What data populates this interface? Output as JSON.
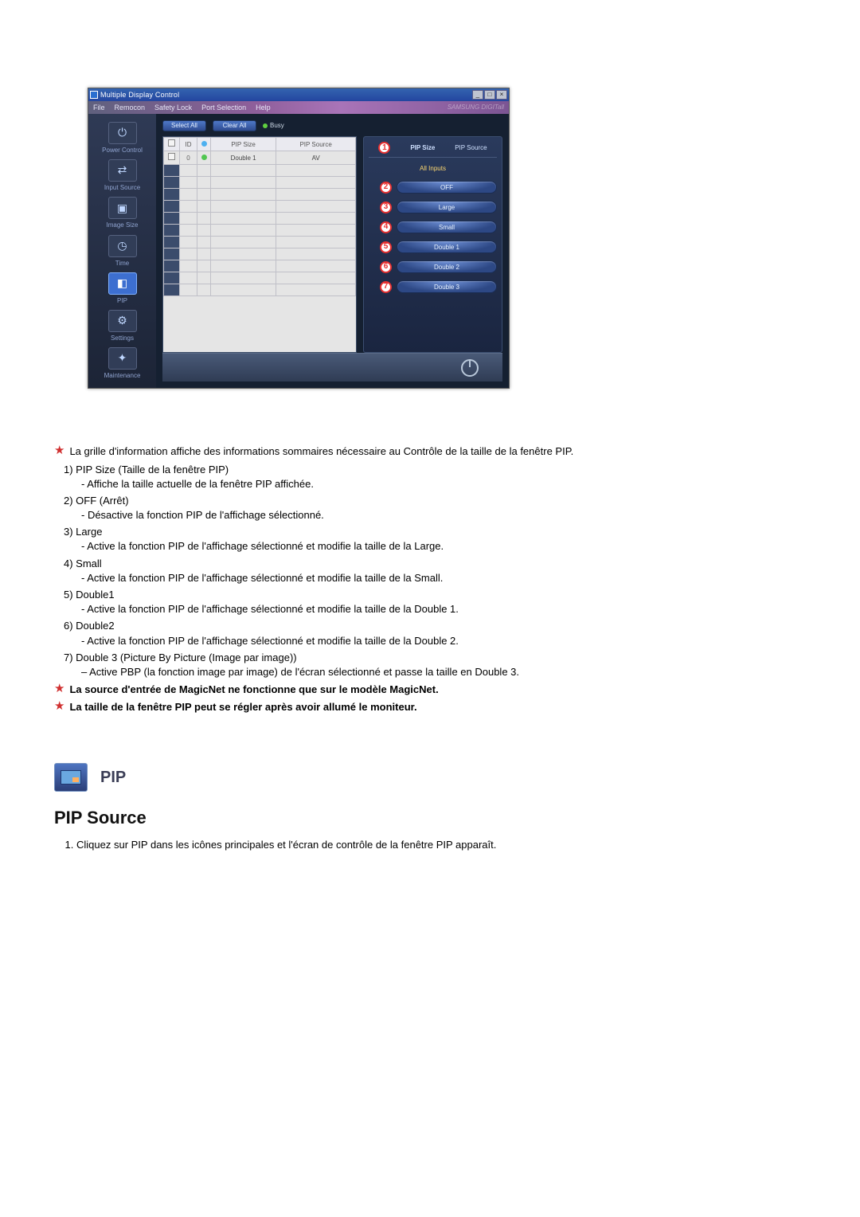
{
  "window": {
    "title": "Multiple Display Control",
    "brand": "SAMSUNG DIGITall"
  },
  "menu": [
    "File",
    "Remocon",
    "Safety Lock",
    "Port Selection",
    "Help"
  ],
  "sidebar": [
    {
      "label": "Power Control",
      "glyph": "⏻"
    },
    {
      "label": "Input Source",
      "glyph": "⇄"
    },
    {
      "label": "Image Size",
      "glyph": "▣"
    },
    {
      "label": "Time",
      "glyph": "◷"
    },
    {
      "label": "PIP",
      "glyph": "◧"
    },
    {
      "label": "Settings",
      "glyph": "⚙"
    },
    {
      "label": "Maintenance",
      "glyph": "✦"
    }
  ],
  "toolbar": {
    "select_all": "Select All",
    "clear_all": "Clear All",
    "busy": "Busy"
  },
  "table": {
    "headers": {
      "id": "ID",
      "pip_size": "PIP Size",
      "pip_source": "PIP Source"
    },
    "row": {
      "id": "0",
      "pip_size": "Double 1",
      "pip_source": "AV"
    }
  },
  "panel": {
    "pip_size_label": "PIP Size",
    "pip_source_label": "PIP Source",
    "all_inputs": "All Inputs",
    "options": [
      "OFF",
      "Large",
      "Small",
      "Double 1",
      "Double 2",
      "Double 3"
    ]
  },
  "notes": {
    "intro": "La grille d'information affiche des informations sommaires nécessaire au Contrôle de la taille de la fenêtre PIP.",
    "items": [
      {
        "h": "1)  PIP Size (Taille de la fenêtre PIP)",
        "b": "- Affiche la taille actuelle de la fenêtre PIP affichée."
      },
      {
        "h": "2)  OFF (Arrêt)",
        "b": "- Désactive la fonction PIP de l'affichage sélectionné."
      },
      {
        "h": "3)  Large",
        "b": "- Active la fonction PIP de l'affichage sélectionné et modifie la taille de la Large."
      },
      {
        "h": "4)  Small",
        "b": "- Active la fonction PIP de l'affichage sélectionné et modifie la taille de la Small."
      },
      {
        "h": "5)  Double1",
        "b": "- Active la fonction PIP de l'affichage sélectionné et modifie la taille de la Double 1."
      },
      {
        "h": "6)  Double2",
        "b": "- Active la fonction PIP de l'affichage sélectionné et modifie la taille de la Double 2."
      },
      {
        "h": "7)  Double 3 (Picture By Picture (Image par image))",
        "b": "– Active PBP (la fonction image par image) de l'écran sélectionné et passe la taille en Double 3."
      }
    ],
    "bold1": "La source d'entrée de MagicNet ne fonctionne que sur le modèle MagicNet.",
    "bold2": "La taille de la fenêtre PIP peut se régler après avoir allumé le moniteur."
  },
  "section": {
    "pip": "PIP",
    "pip_source_h": "PIP Source",
    "step1": "Cliquez sur PIP dans les icônes principales et l'écran de contrôle de la fenêtre PIP apparaît."
  }
}
